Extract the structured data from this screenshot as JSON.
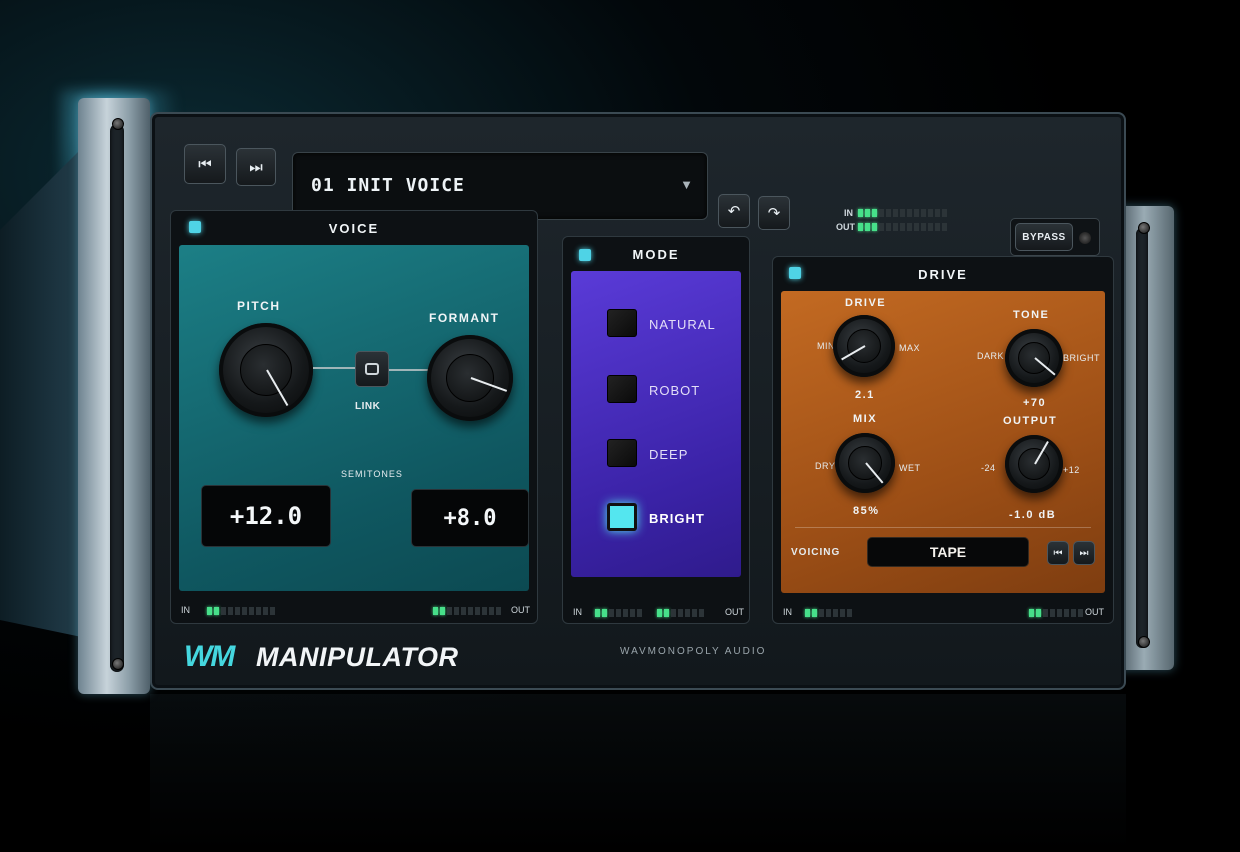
{
  "transport": {
    "prev_icon": "skip-previous-icon",
    "next_icon": "skip-next-icon",
    "prev": "⏮",
    "next": "⏭"
  },
  "preset": {
    "number": "01",
    "name": "INIT VOICE",
    "label": "01  INIT VOICE",
    "arrow": "▼"
  },
  "history": {
    "undo": "↶",
    "redo": "↷"
  },
  "meters": {
    "in_label": "IN",
    "out_label": "OUT"
  },
  "bypass": {
    "label": "BYPASS"
  },
  "voice": {
    "title": "VOICE",
    "pitch_label": "PITCH",
    "formant_label": "FORMANT",
    "link_label": "LINK",
    "units_label": "SEMITONES",
    "pitch_value": "+12.0",
    "formant_value": "+8.0",
    "in_label": "IN",
    "out_label": "OUT"
  },
  "mode": {
    "title": "MODE",
    "options": [
      {
        "label": "NATURAL",
        "selected": false
      },
      {
        "label": "ROBOT",
        "selected": false
      },
      {
        "label": "DEEP",
        "selected": false
      },
      {
        "label": "BRIGHT",
        "selected": true
      }
    ],
    "in_label": "IN",
    "out_label": "OUT"
  },
  "drive": {
    "title": "DRIVE",
    "drive": {
      "label": "DRIVE",
      "min": "MIN",
      "max": "MAX",
      "value": "2.1"
    },
    "tone": {
      "label": "TONE",
      "min": "DARK",
      "max": "BRIGHT",
      "value": "+70"
    },
    "mix": {
      "label": "MIX",
      "min": "DRY",
      "max": "WET",
      "value": "85%"
    },
    "output": {
      "label": "OUTPUT",
      "min": "-24",
      "max": "+12",
      "value": "-1.0 dB"
    },
    "voicing_label": "VOICING",
    "voicing_value": "TAPE",
    "in_label": "IN",
    "out_label": "OUT"
  },
  "footer": {
    "logo": "WM",
    "product": "MANIPULATOR",
    "maker": "WAVMONOPOLY AUDIO"
  },
  "colors": {
    "voice": "#137079",
    "mode": "#4a2fc4",
    "drive": "#b15d1b",
    "led": "#47e08a",
    "accent": "#4fd3e6"
  }
}
